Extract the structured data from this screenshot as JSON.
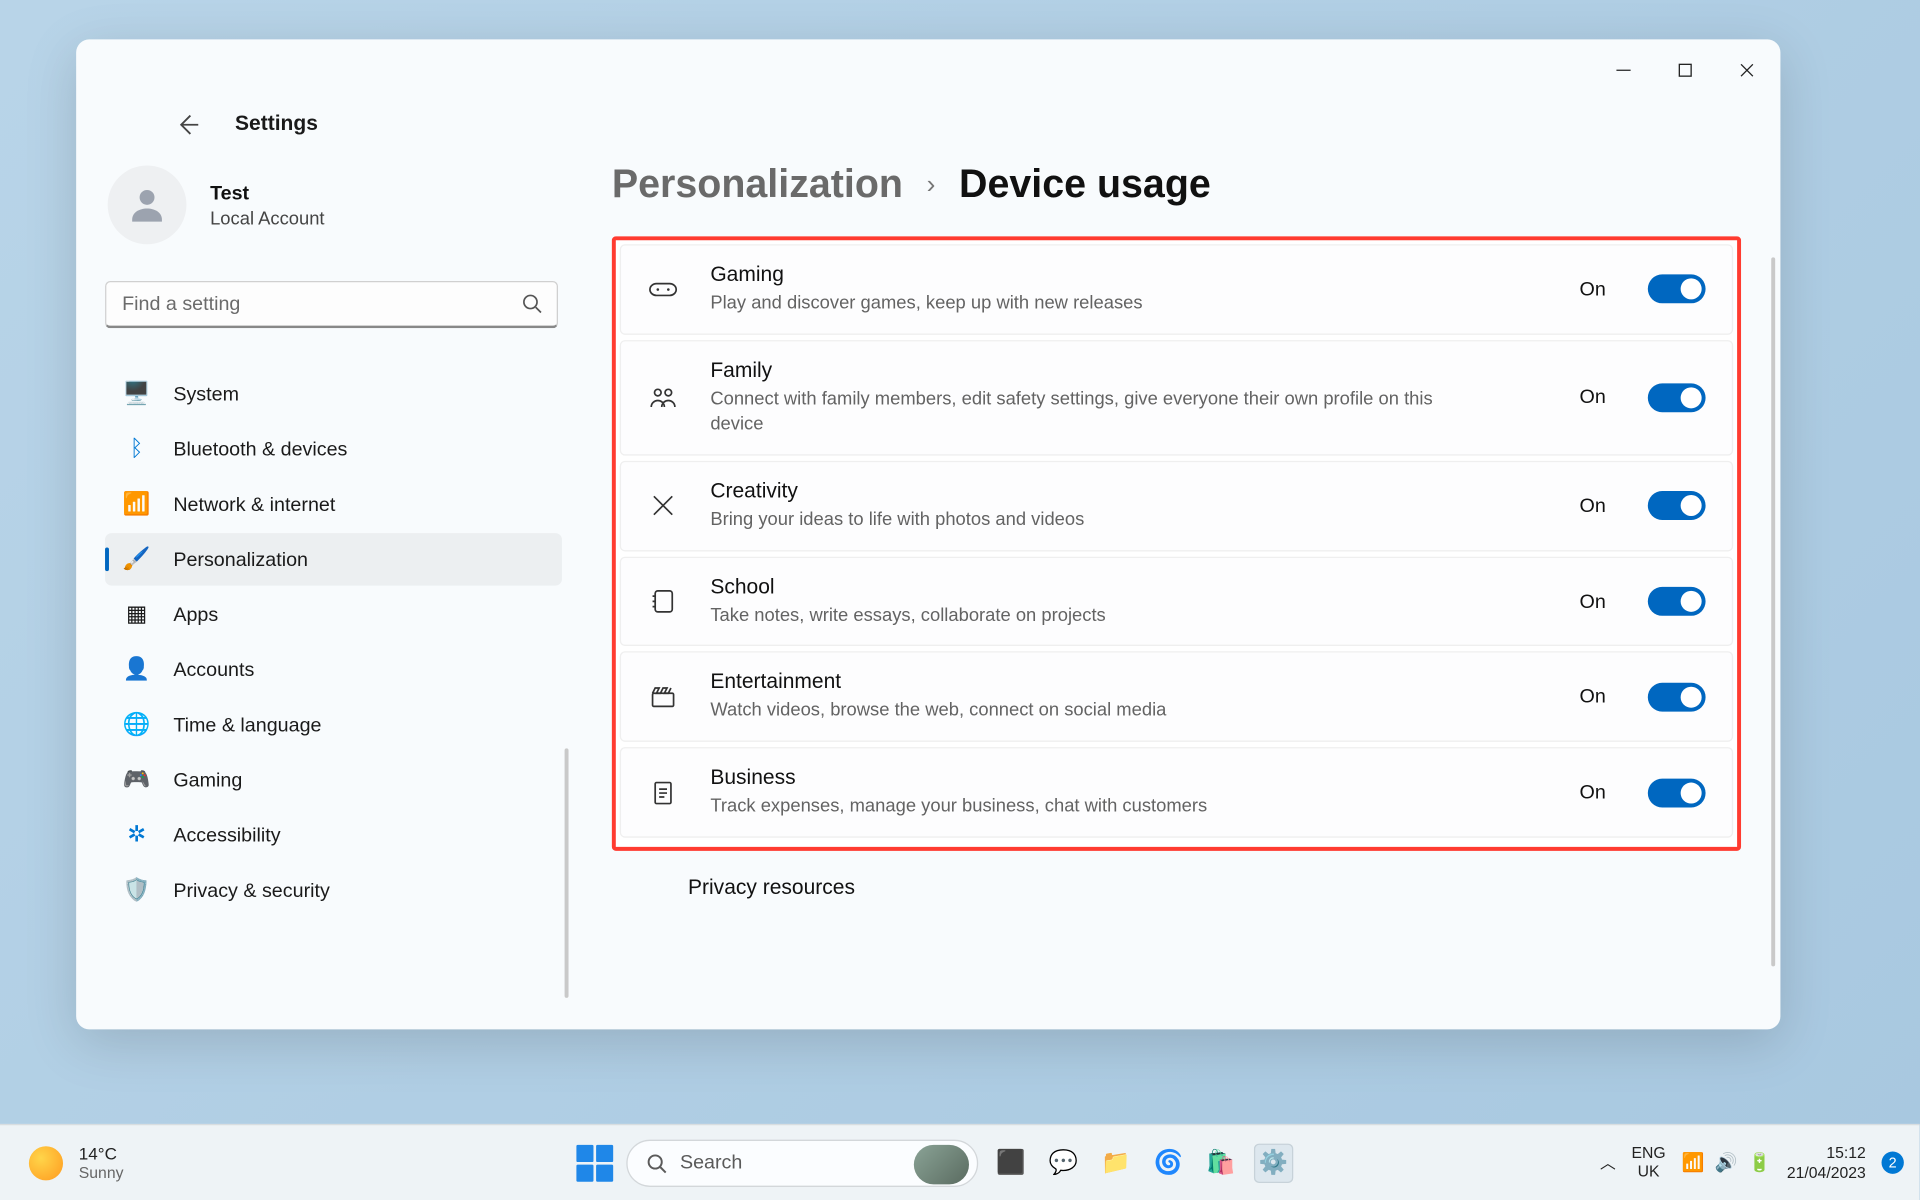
{
  "app": {
    "title": "Settings"
  },
  "profile": {
    "name": "Test",
    "subtitle": "Local Account"
  },
  "search": {
    "placeholder": "Find a setting"
  },
  "nav": {
    "items": [
      {
        "label": "System"
      },
      {
        "label": "Bluetooth & devices"
      },
      {
        "label": "Network & internet"
      },
      {
        "label": "Personalization"
      },
      {
        "label": "Apps"
      },
      {
        "label": "Accounts"
      },
      {
        "label": "Time & language"
      },
      {
        "label": "Gaming"
      },
      {
        "label": "Accessibility"
      },
      {
        "label": "Privacy & security"
      }
    ]
  },
  "breadcrumb": {
    "parent": "Personalization",
    "current": "Device usage"
  },
  "settings": [
    {
      "title": "Gaming",
      "subtitle": "Play and discover games, keep up with new releases",
      "status": "On"
    },
    {
      "title": "Family",
      "subtitle": "Connect with family members, edit safety settings, give everyone their own profile on this device",
      "status": "On"
    },
    {
      "title": "Creativity",
      "subtitle": "Bring your ideas to life with photos and videos",
      "status": "On"
    },
    {
      "title": "School",
      "subtitle": "Take notes, write essays, collaborate on projects",
      "status": "On"
    },
    {
      "title": "Entertainment",
      "subtitle": "Watch videos, browse the web, connect on social media",
      "status": "On"
    },
    {
      "title": "Business",
      "subtitle": "Track expenses, manage your business, chat with customers",
      "status": "On"
    }
  ],
  "privacy_row": "Privacy resources",
  "taskbar": {
    "weather": {
      "temp": "14°C",
      "cond": "Sunny"
    },
    "search_placeholder": "Search",
    "lang": {
      "top": "ENG",
      "bottom": "UK"
    },
    "clock": {
      "time": "15:12",
      "date": "21/04/2023"
    },
    "notif_count": "2"
  }
}
